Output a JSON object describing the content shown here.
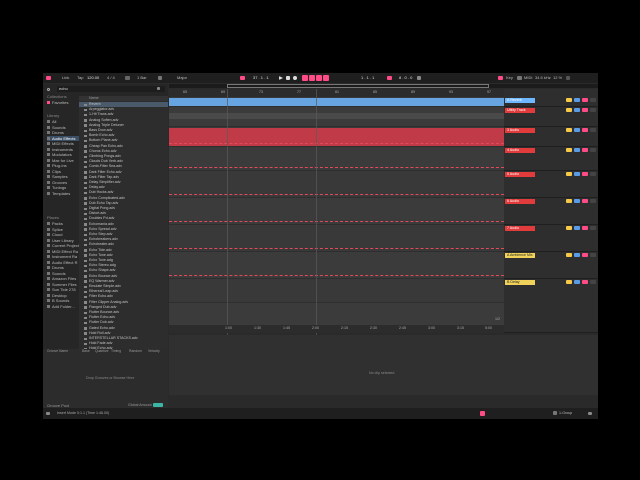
{
  "transport": {
    "live_label": "Link",
    "tap_label": "Tap",
    "tempo": "120.00",
    "signature": "4 / 4",
    "bar_label": "1 Bar",
    "scale_label": "Major",
    "position": "37 . 1 . 1",
    "loop_start": "1 . 1 . 1",
    "loop_length": "8 . 0 . 0",
    "key_label": "Key",
    "midi_label": "MIDI",
    "cpu": "34.5 kHz",
    "cpu_pct": "12 %",
    "accent": "#ff7a1a"
  },
  "browser": {
    "search_value": "echo",
    "collections_title": "Collections",
    "favorites": "Favorites",
    "library_title": "Library",
    "library_items": [
      "All",
      "Sounds",
      "Drums",
      "Audio Effects",
      "MIDI Effects",
      "Instruments",
      "Modulators",
      "Max for Live",
      "Plug-Ins",
      "Clips",
      "Samples",
      "Grooves",
      "Tunings",
      "Templates"
    ],
    "places_title": "Places",
    "places_items": [
      "Packs",
      "Splice",
      "Cloud",
      "User Library",
      "Current Project",
      "MIDI Effect Ra",
      "Instrument Ra",
      "Audio Effect R",
      "Drums",
      "Sounds",
      "Amazon Files",
      "Summer Files",
      "Sun Tide 278",
      "Desktop",
      "B Sounds",
      "Add Folder..."
    ],
    "header_name": "Name",
    "files": [
      "Reverb",
      "Arpeggiator.adv",
      "1-Hit Trans.adv",
      "Analog Soften.adv",
      "Analog Triple Detuner",
      "Bass Door.adv",
      "Bomb Echo.adv",
      "Bottom Plane.adv",
      "Cheap Pan Echo.adv",
      "Chorus Echo.adv",
      "Climbing Pongs.adv",
      "Clouds Dub Verb.adv",
      "Comb-Filter Sea.adv",
      "Dark Filter Echo.adv",
      "Dark Filter Tap.adv",
      "Delay Simplifier.adv",
      "Delay.adv",
      "Dub Hocks.adv",
      "Echo Complicated.adv",
      "Dub Echo Tap.adv",
      "Digital Pong.adv",
      "Distort.adv",
      "Doubles Pd.adv",
      "Echomania.adv",
      "Echo Spread.adv",
      "Echo Step.adv",
      "Echobreakers.adv",
      "Echobeater.adv",
      "Echo Tide.adv",
      "Echo Tone.adv",
      "Echo Tone.adg",
      "Echo Stereo.adg",
      "Echo Shape.adv",
      "Echo Bounce.adv",
      "EQ Warmer.adv",
      "Emulate Simple.adv",
      "Ethereal Leap.adv",
      "Filter Echo.adv",
      "Filter Clipper Analog.adv",
      "Flanged Dub.adv",
      "Flutter Bounce.adv",
      "Flutter Echo.adv",
      "Flutter Dub.adv",
      "Gated Echo.adv",
      "Hold Roll.adv",
      "INTERSTELLAR STACKS.adv",
      "Hold Fade.adv",
      "Hold Echo.adv",
      "Hollow Tone.adv",
      "Hot Tape Flutter.adv",
      "Hyper Tone.adv"
    ],
    "results": "3 Items selected",
    "groove_headers": [
      "Groove Name",
      "Base",
      "Quantize",
      "Timing",
      "Random",
      "Velocity"
    ],
    "groove_hint": "Drop Grooves or Browse Here",
    "groove_pool": "Groove Pool",
    "global_amount": "Global Amount"
  },
  "timeline": {
    "bars": [
      "65",
      "69",
      "73",
      "77",
      "81",
      "85",
      "89",
      "93",
      "97"
    ],
    "times": [
      "1:00",
      "1:30",
      "1:45",
      "2:00",
      "2:15",
      "2:30",
      "2:45",
      "3:00",
      "3:15"
    ],
    "bottom_time": "5:00",
    "page": "1/2"
  },
  "tracks": [
    {
      "name": "A Reverb",
      "color": "#6fb8ff"
    },
    {
      "name": "Utility Track",
      "color": "#e23b3b"
    },
    {
      "name": "3 Audio",
      "color": "#e23b3b"
    },
    {
      "name": "4 Audio",
      "color": "#e23b3b"
    },
    {
      "name": "5 Audio",
      "color": "#e23b3b"
    },
    {
      "name": "6 Audio",
      "color": "#e23b3b"
    },
    {
      "name": "7 Audio",
      "color": "#e23b3b"
    },
    {
      "name": "A Ambience Mix",
      "color": "#f0d25b"
    },
    {
      "name": "B Delay",
      "color": "#f0d25b"
    }
  ],
  "mixer_labels": {
    "input": "Ext. In",
    "monitor": "Auto",
    "main": "Main",
    "route": "1 All Chann"
  },
  "detail": {
    "empty_hint": "No clip selected"
  },
  "status": {
    "message": "Insert Mode 0:1.1 (Time 1:46.00)",
    "group": "1-Group"
  }
}
